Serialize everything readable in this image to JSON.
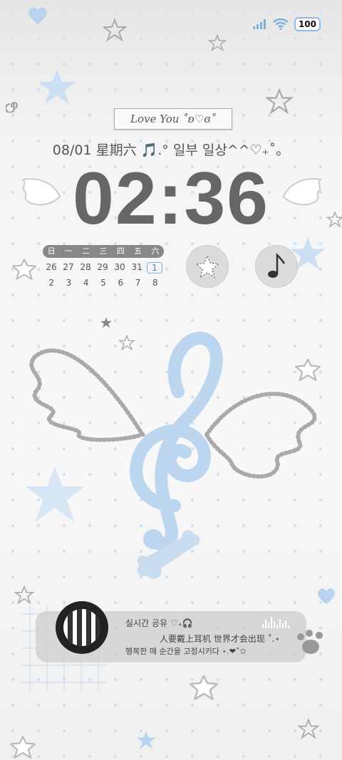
{
  "status": {
    "battery": "100",
    "signal_icon": "signal-icon",
    "wifi_icon": "wifi-icon"
  },
  "tag": {
    "text": "Love You ˚ʚ♡ɞ˚"
  },
  "lockscreen": {
    "date": "08/01 星期六 🎵.° 일부 일상^^♡₊˚。",
    "time": "02:36"
  },
  "calendar": {
    "weekdays": [
      "日",
      "一",
      "二",
      "三",
      "四",
      "五",
      "六"
    ],
    "row1": [
      "26",
      "27",
      "28",
      "29",
      "30",
      "31",
      "1"
    ],
    "row2": [
      "2",
      "3",
      "4",
      "5",
      "6",
      "7",
      "8"
    ],
    "today": "1"
  },
  "shortcuts": {
    "left_icon": "star-icon",
    "right_icon": "music-note-icon"
  },
  "music": {
    "title": "실시간 공유 ♡₊🎧",
    "line2": "人要戴上耳机 世界才会出现 ˚.⋆",
    "line3": "행복한 매 순간을 고정시키다 ⋆.❤˚✩"
  },
  "colors": {
    "accent": "#8fb9e6",
    "clock": "#666666",
    "card": "#cdcdcd"
  }
}
